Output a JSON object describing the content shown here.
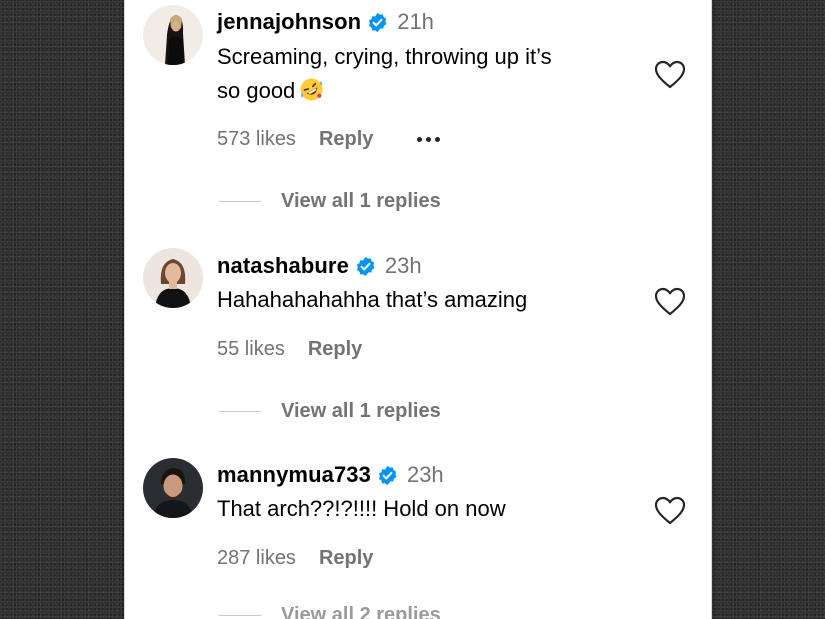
{
  "comments": [
    {
      "username": "jennajohnson",
      "verified": true,
      "time": "21h",
      "text": "Screaming, crying, throwing up it’s\nso good",
      "emoji": "rolling-on-floor-laughing-emoji",
      "likes": "573 likes",
      "reply": "Reply",
      "has_more_menu": true,
      "view_replies": "View all 1 replies"
    },
    {
      "username": "natashabure",
      "verified": true,
      "time": "23h",
      "text": "Hahahahahahha that’s amazing",
      "likes": "55 likes",
      "reply": "Reply",
      "view_replies": "View all 1 replies"
    },
    {
      "username": "mannymua733",
      "verified": true,
      "time": "23h",
      "text": "That arch??!?!!!! Hold on now",
      "likes": "287 likes",
      "reply": "Reply",
      "view_replies": "View all 2 replies"
    }
  ],
  "colors": {
    "verified_badge": "#0095f6",
    "secondary_text": "#737373",
    "primary_text": "#000000"
  }
}
